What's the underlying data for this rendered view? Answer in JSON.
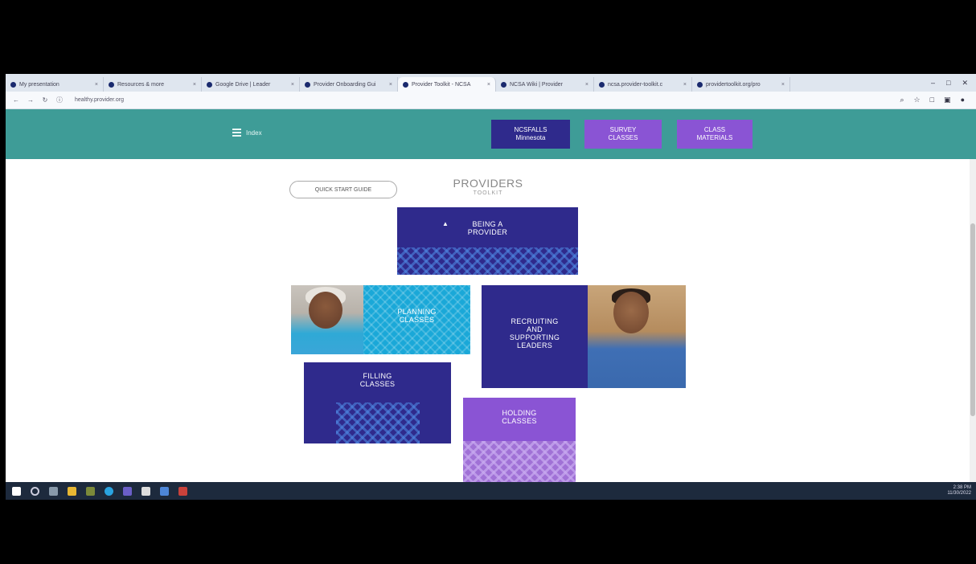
{
  "browser": {
    "tabs": [
      {
        "label": "My presentation",
        "active": false
      },
      {
        "label": "Resources & more",
        "active": false
      },
      {
        "label": "Google Drive | Leader",
        "active": false
      },
      {
        "label": "Provider Onboarding Gui",
        "active": false
      },
      {
        "label": "Provider Toolkit - NCSA",
        "active": true
      },
      {
        "label": "NCSA Wiki | Provider",
        "active": false
      },
      {
        "label": "ncsa.provider-toolkit.c",
        "active": false
      },
      {
        "label": "providertoolkit.org/pro",
        "active": false
      }
    ],
    "url": "healthy.provider.org",
    "window_controls": [
      "–",
      "□",
      "✕"
    ]
  },
  "header": {
    "menu_label": "Index",
    "buttons": [
      {
        "line1": "NCSFALLS",
        "line2": "Minnesota"
      },
      {
        "line1": "SURVEY",
        "line2": "CLASSES"
      },
      {
        "line1": "CLASS",
        "line2": "MATERIALS"
      }
    ]
  },
  "content": {
    "quick_start": "QUICK START GUIDE",
    "title": "PROVIDERS",
    "subtitle": "TOOLKIT",
    "cards": {
      "being_provider": {
        "line1": "BEING A",
        "line2": "PROVIDER"
      },
      "planning": {
        "line1": "PLANNING",
        "line2": "CLASSES"
      },
      "recruiting": {
        "line1": "RECRUITING",
        "line2": "AND",
        "line3": "SUPPORTING",
        "line4": "LEADERS"
      },
      "filling": {
        "line1": "FILLING",
        "line2": "CLASSES"
      },
      "holding": {
        "line1": "HOLDING",
        "line2": "CLASSES"
      }
    }
  },
  "taskbar": {
    "time": "2:38 PM",
    "date": "11/30/2022"
  },
  "colors": {
    "header_teal": "#3e9c97",
    "dark_purple": "#2f2a8c",
    "light_purple": "#8a54d4",
    "cyan": "#1aa8d8"
  }
}
